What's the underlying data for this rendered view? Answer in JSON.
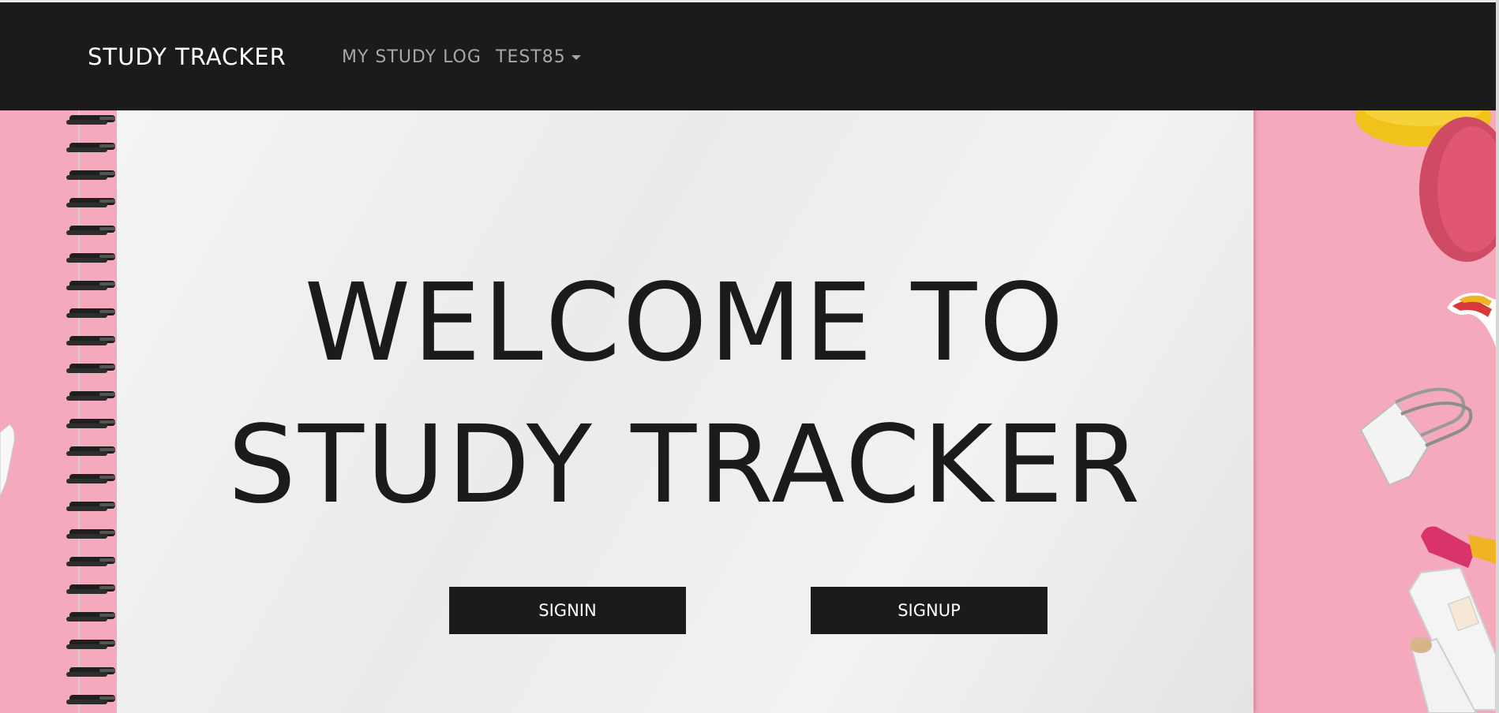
{
  "navbar": {
    "brand": "STUDY TRACKER",
    "links": [
      {
        "label": "MY STUDY LOG"
      },
      {
        "label": "TEST85"
      }
    ]
  },
  "hero": {
    "heading_line1": "WELCOME TO",
    "heading_line2": "STUDY TRACKER",
    "signin_label": "SIGNIN",
    "signup_label": "SIGNUP"
  },
  "colors": {
    "navbar_bg": "#1b1b1b",
    "button_bg": "#1b1b1b",
    "page_bg": "#f4a9bd",
    "paper": "#f0f0f0"
  },
  "icons": {
    "dropdown": "caret-down-icon"
  }
}
